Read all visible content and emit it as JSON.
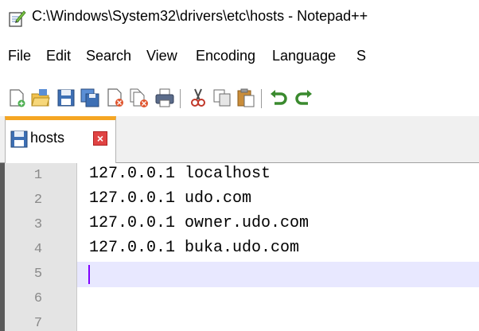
{
  "window": {
    "title": "C:\\Windows\\System32\\drivers\\etc\\hosts - Notepad++",
    "icon": "notepad-icon"
  },
  "menu": {
    "items": [
      "File",
      "Edit",
      "Search",
      "View",
      "Encoding",
      "Language",
      "S"
    ]
  },
  "toolbar": {
    "buttons": [
      "new-file-icon",
      "open-file-icon",
      "save-icon",
      "save-all-icon",
      "close-file-icon",
      "close-all-icon",
      "print-icon",
      "cut-icon",
      "copy-icon",
      "paste-icon",
      "undo-icon",
      "redo-icon"
    ]
  },
  "tabs": [
    {
      "label": "hosts",
      "icon": "save-disk-icon",
      "close": "×",
      "active": true
    }
  ],
  "editor": {
    "lines": [
      {
        "num": "1",
        "text": "127.0.0.1 localhost"
      },
      {
        "num": "2",
        "text": "127.0.0.1 udo.com"
      },
      {
        "num": "3",
        "text": "127.0.0.1 owner.udo.com"
      },
      {
        "num": "4",
        "text": "127.0.0.1 buka.udo.com"
      },
      {
        "num": "5",
        "text": ""
      },
      {
        "num": "6",
        "text": ""
      },
      {
        "num": "7",
        "text": ""
      }
    ],
    "current_line": "5",
    "colors": {
      "accent": "#f5a623",
      "caret": "#8000ff",
      "current_line_bg": "#e8e8ff"
    }
  }
}
